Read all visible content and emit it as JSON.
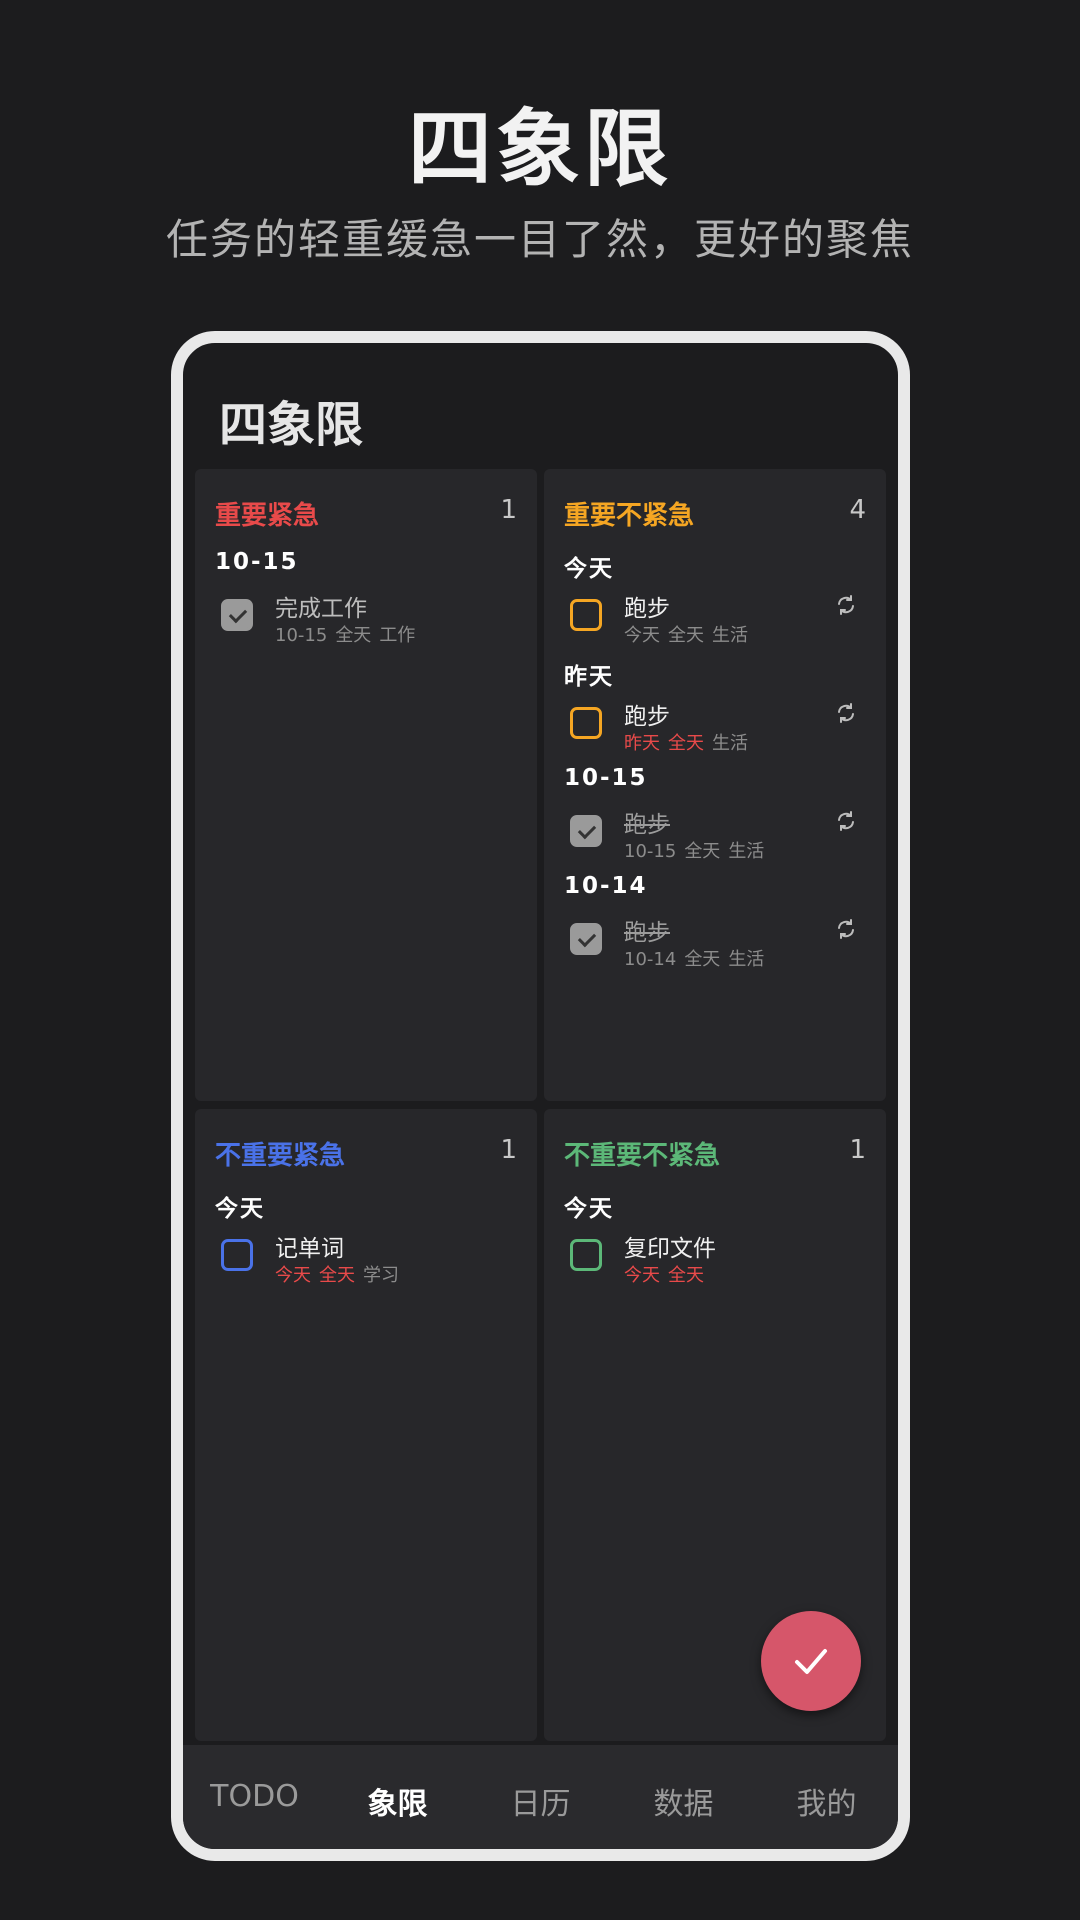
{
  "hero": {
    "title": "四象限",
    "subtitle": "任务的轻重缓急一目了然，更好的聚焦"
  },
  "screen": {
    "title": "四象限"
  },
  "quadrants": [
    {
      "title": "重要紧急",
      "color": "#e84a4a",
      "count": "1",
      "groups": [
        {
          "label": "10-15",
          "tasks": [
            {
              "name": "完成工作",
              "date": "10-15",
              "time": "全天",
              "tag": "工作",
              "done": true,
              "repeat": false,
              "overdue": false
            }
          ]
        }
      ]
    },
    {
      "title": "重要不紧急",
      "color": "#f5a623",
      "count": "4",
      "groups": [
        {
          "label": "今天",
          "tasks": [
            {
              "name": "跑步",
              "date": "今天",
              "time": "全天",
              "tag": "生活",
              "done": false,
              "repeat": true,
              "overdue": false
            }
          ]
        },
        {
          "label": "昨天",
          "tasks": [
            {
              "name": "跑步",
              "date": "昨天",
              "time": "全天",
              "tag": "生活",
              "done": false,
              "repeat": true,
              "overdue": true
            }
          ]
        },
        {
          "label": "10-15",
          "tasks": [
            {
              "name": "跑步",
              "date": "10-15",
              "time": "全天",
              "tag": "生活",
              "done": true,
              "repeat": true,
              "overdue": false
            }
          ]
        },
        {
          "label": "10-14",
          "tasks": [
            {
              "name": "跑步",
              "date": "10-14",
              "time": "全天",
              "tag": "生活",
              "done": true,
              "repeat": true,
              "overdue": false
            }
          ]
        }
      ]
    },
    {
      "title": "不重要紧急",
      "color": "#4a72e8",
      "count": "1",
      "groups": [
        {
          "label": "今天",
          "tasks": [
            {
              "name": "记单词",
              "date": "今天",
              "time": "全天",
              "tag": "学习",
              "done": false,
              "repeat": false,
              "overdue": true
            }
          ]
        }
      ]
    },
    {
      "title": "不重要不紧急",
      "color": "#5cb878",
      "count": "1",
      "groups": [
        {
          "label": "今天",
          "tasks": [
            {
              "name": "复印文件",
              "date": "今天",
              "time": "全天",
              "tag": "",
              "done": false,
              "repeat": false,
              "overdue": true
            }
          ]
        }
      ]
    }
  ],
  "tabs": [
    {
      "label": "TODO",
      "active": false
    },
    {
      "label": "象限",
      "active": true
    },
    {
      "label": "日历",
      "active": false
    },
    {
      "label": "数据",
      "active": false
    },
    {
      "label": "我的",
      "active": false
    }
  ],
  "colors": {
    "fab": "#d6566a",
    "done_checkbox": "#9a9a9a",
    "overdue": "#e84a4a"
  },
  "icons": {
    "fab": "check-icon",
    "repeat": "repeat-icon"
  }
}
